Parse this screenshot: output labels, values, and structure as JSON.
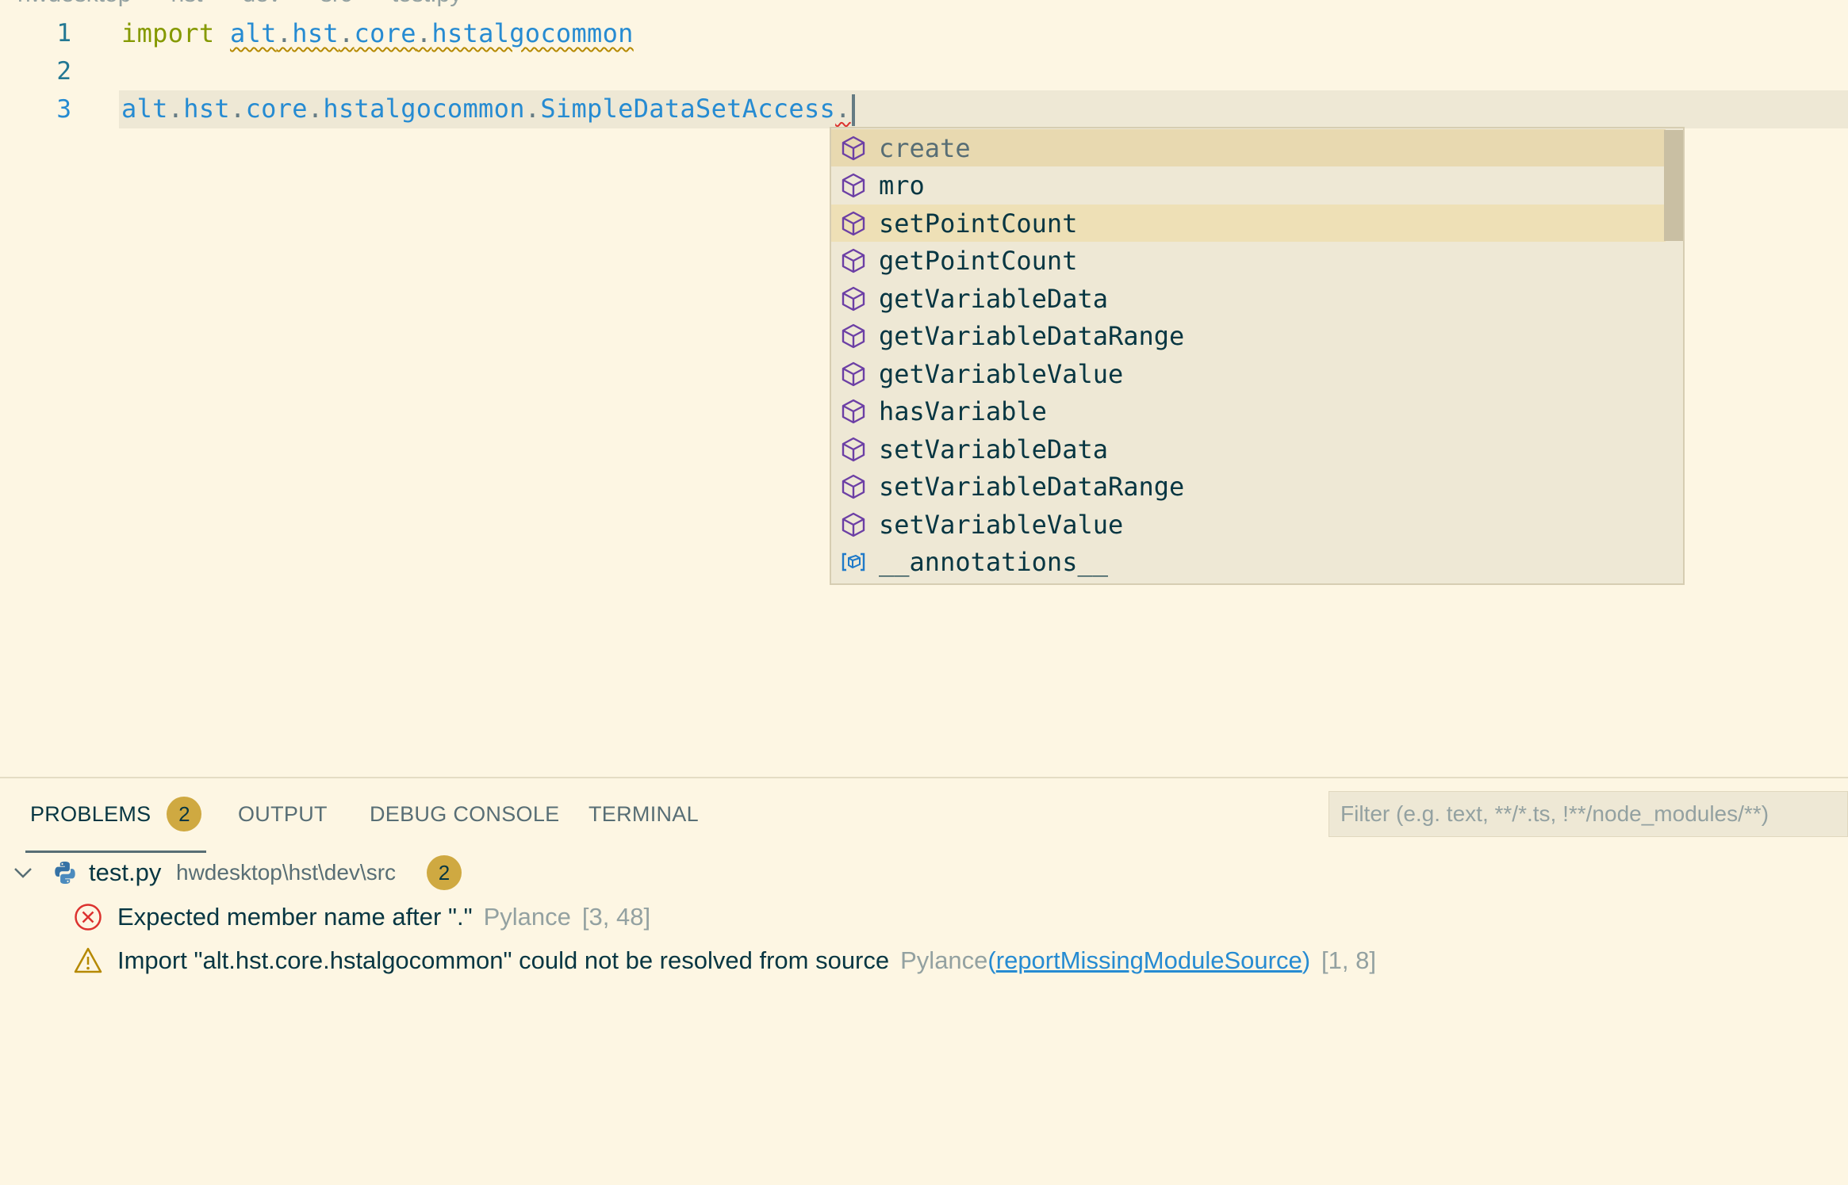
{
  "breadcrumb": {
    "items": [
      "hwdesktop",
      "hst",
      "dev",
      "src",
      "test.py"
    ],
    "separator": "›"
  },
  "editor": {
    "lines": [
      {
        "number": "1",
        "keyword": "import",
        "module": [
          "alt",
          "hst",
          "core",
          "hstalgocommon"
        ]
      },
      {
        "number": "2"
      },
      {
        "number": "3",
        "module": [
          "alt",
          "hst",
          "core",
          "hstalgocommon",
          "SimpleDataSetAccess"
        ],
        "trailing": "."
      }
    ],
    "colors": {
      "background": "#fdf6e3",
      "keyword": "#859900",
      "identifier": "#268bd2",
      "current_line": "#eee8d5"
    }
  },
  "suggest": {
    "items": [
      {
        "label": "create",
        "icon": "method-cube-icon",
        "state": "selected"
      },
      {
        "label": "mro",
        "icon": "method-cube-icon",
        "state": "normal"
      },
      {
        "label": "setPointCount",
        "icon": "method-cube-icon",
        "state": "hover"
      },
      {
        "label": "getPointCount",
        "icon": "method-cube-icon",
        "state": "normal"
      },
      {
        "label": "getVariableData",
        "icon": "method-cube-icon",
        "state": "normal"
      },
      {
        "label": "getVariableDataRange",
        "icon": "method-cube-icon",
        "state": "normal"
      },
      {
        "label": "getVariableValue",
        "icon": "method-cube-icon",
        "state": "normal"
      },
      {
        "label": "hasVariable",
        "icon": "method-cube-icon",
        "state": "normal"
      },
      {
        "label": "setVariableData",
        "icon": "method-cube-icon",
        "state": "normal"
      },
      {
        "label": "setVariableDataRange",
        "icon": "method-cube-icon",
        "state": "normal"
      },
      {
        "label": "setVariableValue",
        "icon": "method-cube-icon",
        "state": "normal"
      },
      {
        "label": "__annotations__",
        "icon": "variable-icon",
        "state": "normal"
      }
    ]
  },
  "panel": {
    "tabs": [
      {
        "label": "PROBLEMS",
        "badge": "2",
        "active": true
      },
      {
        "label": "OUTPUT"
      },
      {
        "label": "DEBUG CONSOLE"
      },
      {
        "label": "TERMINAL"
      }
    ],
    "filter_placeholder": "Filter (e.g. text, **/*.ts, !**/node_modules/**)",
    "file": {
      "name": "test.py",
      "path": "hwdesktop\\hst\\dev\\src",
      "count": "2"
    },
    "problems": [
      {
        "severity": "error",
        "message": "Expected member name after \".\"",
        "source": "Pylance",
        "position": "[3, 48]"
      },
      {
        "severity": "warning",
        "message": "Import \"alt.hst.core.hstalgocommon\" could not be resolved from source",
        "source": "Pylance",
        "rule": "reportMissingModuleSource",
        "position": "[1, 8]"
      }
    ]
  }
}
